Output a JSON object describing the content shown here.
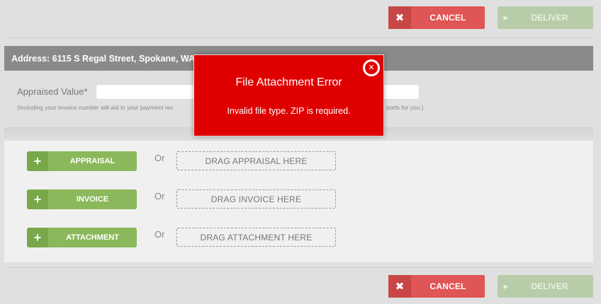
{
  "actions": {
    "cancel_label": "CANCEL",
    "cancel_icon": "x-icon",
    "deliver_label": "DELIVER",
    "deliver_icon": "play-icon"
  },
  "colors": {
    "cancel": "#e05555",
    "deliver_disabled": "#b7cdaa",
    "upload_button": "#8bb85a",
    "error_modal": "#df0000",
    "address_bar": "#8a8a8a"
  },
  "address": {
    "text": "Address: 6115 S Regal Street, Spokane, WA, 9"
  },
  "appraisal_form": {
    "value_label": "Appraised Value*",
    "value_input": "",
    "helper_start": "(Including your invoice number will aid in your payment rec",
    "helper_end": "ports for you.)"
  },
  "uploads": [
    {
      "button_label": "APPRAISAL",
      "or_label": "Or",
      "drop_label": "DRAG APPRAISAL HERE"
    },
    {
      "button_label": "INVOICE",
      "or_label": "Or",
      "drop_label": "DRAG INVOICE HERE"
    },
    {
      "button_label": "ATTACHMENT",
      "or_label": "Or",
      "drop_label": "DRAG ATTACHMENT HERE"
    }
  ],
  "error_modal": {
    "title": "File Attachment Error",
    "message": "Invalid file type. ZIP is required.",
    "close_icon": "close-circle-icon"
  }
}
